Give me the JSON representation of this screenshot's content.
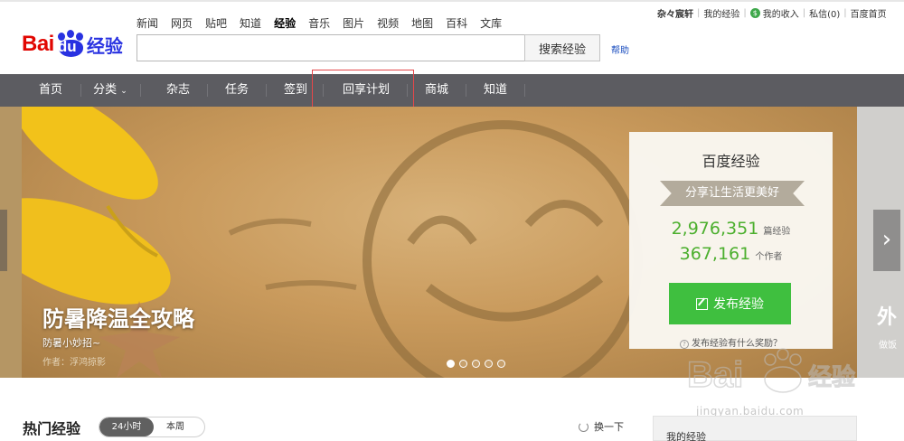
{
  "logo": {
    "bai": "Bai",
    "du": "du",
    "jingyan": "经验"
  },
  "top_nav": [
    "新闻",
    "网页",
    "贴吧",
    "知道",
    "经验",
    "音乐",
    "图片",
    "视频",
    "地图",
    "百科",
    "文库"
  ],
  "search": {
    "value": "",
    "button": "搜索经验",
    "help": "帮助"
  },
  "user_bar": {
    "username": "杂々宸轩",
    "my_exp": "我的经验",
    "my_income": "我的收入",
    "messages": "私信(0)",
    "home": "百度首页"
  },
  "main_nav": [
    "首页",
    "分类",
    "杂志",
    "任务",
    "签到",
    "回享计划",
    "商城",
    "知道"
  ],
  "banner": {
    "title": "防暑降温全攻略",
    "subtitle": "防暑小妙招~",
    "author": "作者：浮鸿掠影",
    "right_ghost_title": "外",
    "right_ghost_sub": "做饭"
  },
  "card": {
    "title": "百度经验",
    "slogan": "分享让生活更美好",
    "articles_count": "2,976,351",
    "articles_unit": "篇经验",
    "authors_count": "367,161",
    "authors_unit": "个作者",
    "publish_button": "发布经验",
    "reward_link": "发布经验有什么奖励？"
  },
  "hot": {
    "title": "热门经验",
    "tab_active": "24小时",
    "tab_inactive": "本周",
    "refresh": "换一下"
  },
  "sidebar": {
    "my_exp_title": "我的经验"
  },
  "watermark": {
    "logo": "Bai 经验",
    "url": "jingyan.baidu.com"
  },
  "colors": {
    "brand_red": "#e10601",
    "brand_blue": "#2932e1",
    "nav_bg": "#5c5c61",
    "green": "#3fbf3f"
  }
}
